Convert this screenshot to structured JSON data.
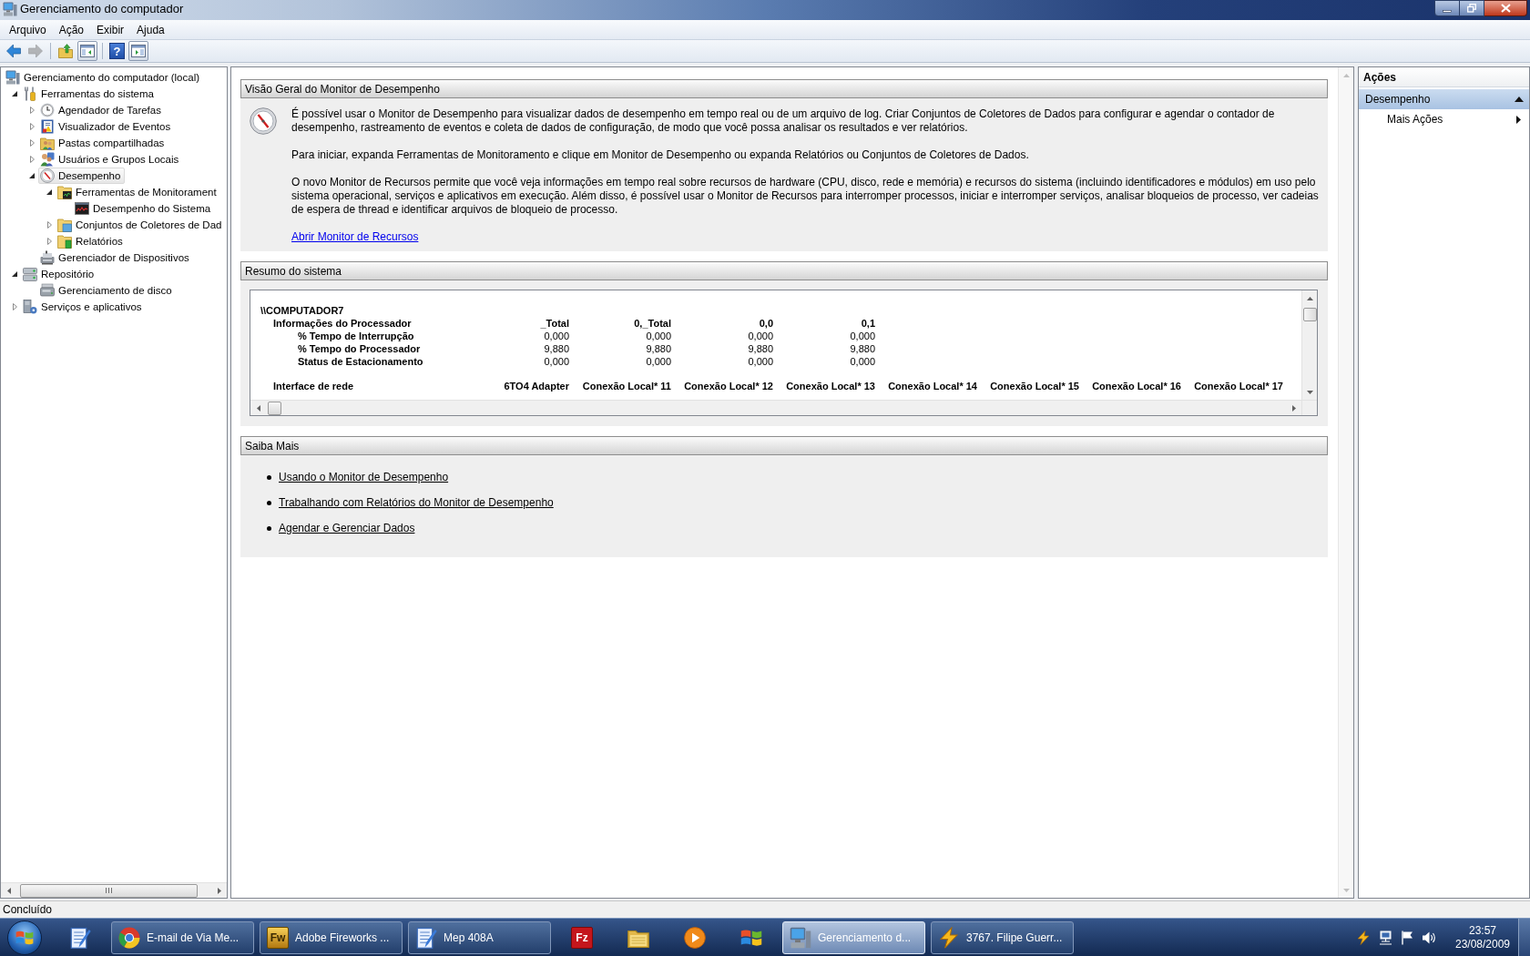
{
  "window": {
    "title": "Gerenciamento do computador"
  },
  "menu": [
    "Arquivo",
    "Ação",
    "Exibir",
    "Ajuda"
  ],
  "toolbar": {
    "groups": [
      [
        {
          "kind": "back",
          "disabled": false,
          "pressed": false
        },
        {
          "kind": "forward",
          "disabled": true,
          "pressed": false
        }
      ],
      [
        {
          "kind": "up",
          "disabled": false,
          "pressed": false
        },
        {
          "kind": "console_tree",
          "disabled": false,
          "pressed": true
        }
      ],
      [
        {
          "kind": "help",
          "glyph": "?",
          "disabled": false,
          "pressed": false
        },
        {
          "kind": "action_pane",
          "disabled": false,
          "pressed": true
        }
      ]
    ]
  },
  "tree": {
    "root": {
      "label": "Gerenciamento do computador (local)",
      "kind": "computer",
      "selected": false,
      "children": [
        {
          "label": "Ferramentas do sistema",
          "kind": "tools",
          "selected": false,
          "expanded": true,
          "children": [
            {
              "label": "Agendador de Tarefas",
              "kind": "clock",
              "selected": false,
              "expanded": false
            },
            {
              "label": "Visualizador de Eventos",
              "kind": "event_log",
              "selected": false,
              "expanded": false
            },
            {
              "label": "Pastas compartilhadas",
              "kind": "shared_folder",
              "selected": false,
              "expanded": false
            },
            {
              "label": "Usuários e Grupos Locais",
              "kind": "users",
              "selected": false,
              "expanded": false
            },
            {
              "label": "Desempenho",
              "kind": "gauge",
              "selected": true,
              "expanded": true,
              "children": [
                {
                  "label": "Ferramentas de Monitorament",
                  "kind": "chart_folder",
                  "selected": false,
                  "expanded": true,
                  "children": [
                    {
                      "label": "Desempenho do Sistema",
                      "kind": "line_chart",
                      "selected": false
                    }
                  ]
                },
                {
                  "label": "Conjuntos de Coletores de Dad",
                  "kind": "collector_folder",
                  "selected": false,
                  "expanded": false
                },
                {
                  "label": "Relatórios",
                  "kind": "report_folder",
                  "selected": false,
                  "expanded": false
                }
              ]
            },
            {
              "label": "Gerenciador de Dispositivos",
              "kind": "devices",
              "selected": false
            }
          ]
        },
        {
          "label": "Repositório",
          "kind": "storage",
          "selected": false,
          "expanded": true,
          "children": [
            {
              "label": "Gerenciamento de disco",
              "kind": "disk",
              "selected": false
            }
          ]
        },
        {
          "label": "Serviços e aplicativos",
          "kind": "services",
          "selected": false,
          "expanded": false
        }
      ]
    }
  },
  "overview": {
    "title": "Visão Geral do Monitor de Desempenho",
    "paragraphs": [
      "É possível usar o Monitor de Desempenho para visualizar dados de desempenho em tempo real ou de um arquivo de log. Criar Conjuntos de Coletores de Dados para configurar e agendar o contador de desempenho, rastreamento de eventos e coleta de dados de configuração, de modo que você possa analisar os resultados e ver relatórios.",
      "Para iniciar, expanda Ferramentas de Monitoramento e clique em Monitor de Desempenho ou expanda Relatórios ou Conjuntos de Coletores de Dados.",
      "O novo Monitor de Recursos permite que você veja informações em tempo real sobre recursos de hardware (CPU, disco, rede e memória) e recursos do sistema (incluindo identificadores e módulos) em uso pelo sistema operacional, serviços e aplicativos em execução. Além disso, é possível usar o Monitor de Recursos para interromper processos, iniciar e interromper serviços, analisar bloqueios de processo, ver cadeias de espera de thread e identificar arquivos de bloqueio de processo."
    ],
    "link": "Abrir Monitor de Recursos"
  },
  "system_summary": {
    "title": "Resumo do sistema",
    "computer": "\\\\COMPUTADOR7",
    "groups": [
      {
        "name": "Informações do Processador",
        "columns": [
          "_Total",
          "0,_Total",
          "0,0",
          "0,1"
        ],
        "rows": [
          {
            "label": "% Tempo de Interrupção",
            "values": [
              "0,000",
              "0,000",
              "0,000",
              "0,000"
            ]
          },
          {
            "label": "% Tempo do Processador",
            "values": [
              "9,880",
              "9,880",
              "9,880",
              "9,880"
            ]
          },
          {
            "label": "Status de Estacionamento",
            "values": [
              "0,000",
              "0,000",
              "0,000",
              "0,000"
            ]
          }
        ]
      },
      {
        "name": "Interface de rede",
        "columns": [
          "6TO4 Adapter",
          "Conexão Local* 11",
          "Conexão Local* 12",
          "Conexão Local* 13",
          "Conexão Local* 14",
          "Conexão Local* 15",
          "Conexão Local* 16",
          "Conexão Local* 17"
        ]
      }
    ]
  },
  "learn_more": {
    "title": "Saiba Mais",
    "links": [
      "Usando o Monitor de Desempenho",
      "Trabalhando com Relatórios do Monitor de Desempenho",
      "Agendar e Gerenciar Dados"
    ]
  },
  "actions_pane": {
    "title": "Ações",
    "sections": [
      {
        "title": "Desempenho",
        "expanded": true,
        "items": [
          {
            "label": "Mais Ações",
            "submenu": true
          }
        ]
      }
    ]
  },
  "status_bar": {
    "text": "Concluído"
  },
  "taskbar": {
    "items": [
      {
        "kind": "notepad",
        "selected": false
      },
      {
        "kind": "chrome",
        "label": "E-mail de Via Me...",
        "selected": false
      },
      {
        "kind": "fireworks",
        "logo": "Fw",
        "label": "Adobe Fireworks ...",
        "selected": false
      },
      {
        "kind": "notepad",
        "label": "Mep 408A",
        "selected": false
      },
      {
        "kind": "filezilla",
        "logo": "Fz",
        "selected": false
      },
      {
        "kind": "explorer",
        "selected": false
      },
      {
        "kind": "media_player",
        "selected": false
      },
      {
        "kind": "windows",
        "selected": false
      },
      {
        "kind": "computer_management",
        "label": "Gerenciamento d...",
        "selected": true
      },
      {
        "kind": "lightning",
        "label": "3767. Filipe Guerr...",
        "selected": false
      }
    ],
    "tray": [
      {
        "kind": "power"
      },
      {
        "kind": "network"
      },
      {
        "kind": "flag"
      },
      {
        "kind": "speaker"
      }
    ],
    "clock": {
      "time": "23:57",
      "date": "23/08/2009"
    }
  }
}
